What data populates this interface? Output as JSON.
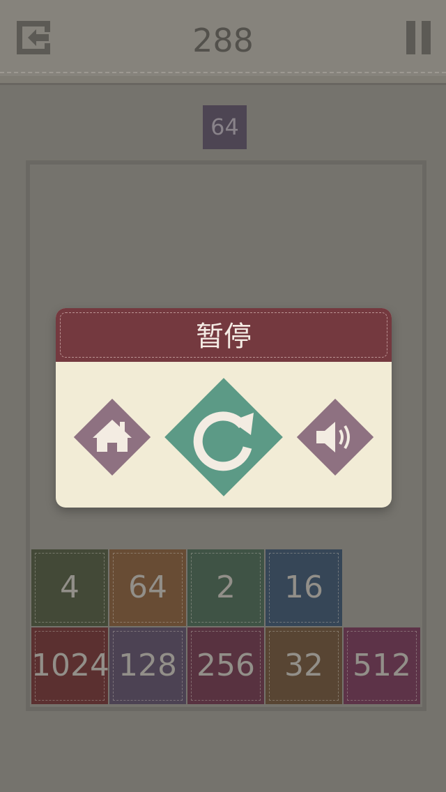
{
  "header": {
    "score": "288",
    "exit_icon": "exit-icon",
    "pause_icon": "pause-icon"
  },
  "next_tile": {
    "value": "64",
    "color": "#4e4656"
  },
  "board": {
    "rows": [
      [
        {
          "value": "4",
          "color": "#424a36"
        },
        {
          "value": "64",
          "color": "#6d4e33"
        },
        {
          "value": "2",
          "color": "#3e5646"
        },
        {
          "value": "16",
          "color": "#34475a"
        }
      ],
      [
        {
          "value": "1024",
          "color": "#5e2e2e"
        },
        {
          "value": "128",
          "color": "#4d4256"
        },
        {
          "value": "256",
          "color": "#5b3040"
        },
        {
          "value": "32",
          "color": "#5a4632"
        },
        {
          "value": "512",
          "color": "#603249"
        }
      ]
    ]
  },
  "pause_dialog": {
    "title": "暂停",
    "header_color": "#74393f",
    "buttons": [
      {
        "name": "home",
        "icon": "home-icon",
        "color": "#8e7181"
      },
      {
        "name": "restart",
        "icon": "restart-icon",
        "color": "#5c9a86"
      },
      {
        "name": "sound",
        "icon": "speaker-icon",
        "color": "#8e7181"
      }
    ]
  }
}
